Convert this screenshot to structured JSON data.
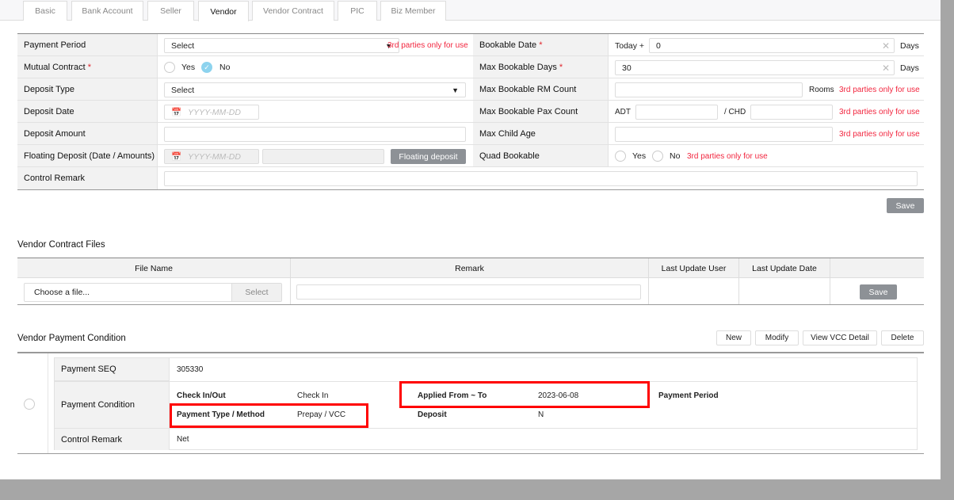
{
  "tabs": [
    "Basic",
    "Bank Account",
    "Seller",
    "Vendor",
    "Vendor Contract",
    "PIC",
    "Biz Member"
  ],
  "active_tab": "Vendor",
  "form": {
    "payment_period": {
      "label": "Payment Period",
      "value": "Select",
      "note": "3rd parties only for use"
    },
    "mutual_contract": {
      "label": "Mutual Contract",
      "required": "*",
      "yes": "Yes",
      "no": "No",
      "selected": "No"
    },
    "deposit_type": {
      "label": "Deposit Type",
      "value": "Select"
    },
    "deposit_date": {
      "label": "Deposit Date",
      "placeholder": "YYYY-MM-DD"
    },
    "deposit_amount": {
      "label": "Deposit Amount",
      "value": ""
    },
    "floating_deposit": {
      "label": "Floating Deposit (Date / Amounts)",
      "placeholder": "YYYY-MM-DD",
      "button": "Floating deposit"
    },
    "control_remark": {
      "label": "Control Remark",
      "value": ""
    },
    "bookable_date": {
      "label": "Bookable Date",
      "required": "*",
      "prefix": "Today +",
      "value": "0",
      "unit": "Days"
    },
    "max_bookable_days": {
      "label": "Max Bookable Days",
      "required": "*",
      "value": "30",
      "unit": "Days"
    },
    "max_rm_count": {
      "label": "Max Bookable RM Count",
      "unit": "Rooms",
      "note": "3rd parties only for use"
    },
    "max_pax_count": {
      "label": "Max Bookable Pax Count",
      "adt": "ADT",
      "chd": "/ CHD",
      "note": "3rd parties only for use"
    },
    "max_child_age": {
      "label": "Max Child Age",
      "note": "3rd parties only for use"
    },
    "quad_bookable": {
      "label": "Quad Bookable",
      "yes": "Yes",
      "no": "No",
      "note": "3rd parties only for use"
    },
    "save": "Save"
  },
  "files": {
    "title": "Vendor Contract Files",
    "headers": [
      "File Name",
      "Remark",
      "Last Update User",
      "Last Update Date"
    ],
    "file_placeholder": "Choose a file...",
    "select": "Select",
    "save": "Save"
  },
  "payment": {
    "title": "Vendor Payment Condition",
    "buttons": [
      "New",
      "Modify",
      "View VCC Detail",
      "Delete"
    ],
    "seq_label": "Payment SEQ",
    "seq": "305330",
    "cond_label": "Payment Condition",
    "check_label": "Check In/Out",
    "check": "Check In",
    "applied_label": "Applied From ~ To",
    "applied": "2023-06-08",
    "period_label": "Payment Period",
    "type_label": "Payment Type / Method",
    "type": "Prepay / VCC",
    "deposit_label": "Deposit",
    "deposit": "N",
    "remark_label": "Control Remark",
    "remark": "Net"
  }
}
